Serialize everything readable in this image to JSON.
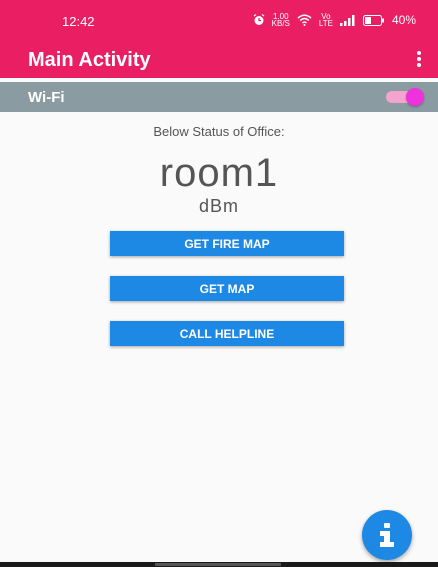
{
  "status_bar": {
    "time": "12:42",
    "net_speed_top": "1.00",
    "net_speed_bottom": "KB/S",
    "volte_top": "Vo",
    "volte_bottom": "LTE",
    "battery_percent": "40%",
    "battery_level": 0.4
  },
  "app_bar": {
    "title": "Main Activity",
    "overflow_icon": "more-vert-icon",
    "color": "#e91e63"
  },
  "wifi_row": {
    "label": "Wi-Fi",
    "toggle_on": true
  },
  "main": {
    "status_heading": "Below Status of Office:",
    "room": "room1",
    "unit": "dBm"
  },
  "buttons": {
    "fire_map": "GET FIRE MAP",
    "map": "GET MAP",
    "helpline": "CALL HELPLINE"
  },
  "fab": {
    "icon": "info-icon",
    "color": "#1e88e5"
  }
}
